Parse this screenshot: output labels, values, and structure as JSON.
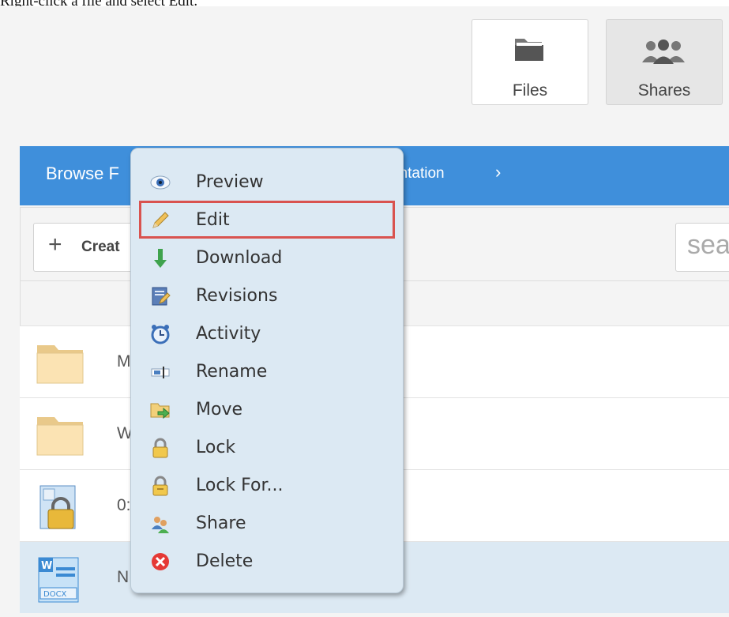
{
  "instruction": "Right-click a file and select Edit.",
  "nav": {
    "files_label": "Files",
    "shares_label": "Shares"
  },
  "breadcrumb": {
    "first": "Browse F",
    "second": "entation",
    "separator": "›"
  },
  "toolbar": {
    "create_label": "Creat",
    "search_placeholder": "sea"
  },
  "files": [
    {
      "name": "M",
      "icon": "folder-icon",
      "selected": false
    },
    {
      "name": "W",
      "icon": "folder-icon",
      "selected": false
    },
    {
      "name": "0:",
      "icon": "locked-file-icon",
      "selected": false
    },
    {
      "name": "N",
      "icon": "docx-file-icon",
      "selected": true
    }
  ],
  "context_menu": {
    "highlighted": "Edit",
    "highlight_color": "#d9534f",
    "items": [
      {
        "label": "Preview",
        "icon": "eye-icon"
      },
      {
        "label": "Edit",
        "icon": "pencil-icon"
      },
      {
        "label": "Download",
        "icon": "download-arrow-icon"
      },
      {
        "label": "Revisions",
        "icon": "revisions-icon"
      },
      {
        "label": "Activity",
        "icon": "alarm-clock-icon"
      },
      {
        "label": "Rename",
        "icon": "rename-icon"
      },
      {
        "label": "Move",
        "icon": "move-folder-icon"
      },
      {
        "label": "Lock",
        "icon": "lock-icon"
      },
      {
        "label": "Lock For...",
        "icon": "lock-timed-icon"
      },
      {
        "label": "Share",
        "icon": "share-users-icon"
      },
      {
        "label": "Delete",
        "icon": "delete-icon"
      }
    ]
  },
  "colors": {
    "breadcrumb_bg": "#3f8fdb",
    "menu_bg": "#dce9f3",
    "selected_row_bg": "#dce9f3"
  }
}
